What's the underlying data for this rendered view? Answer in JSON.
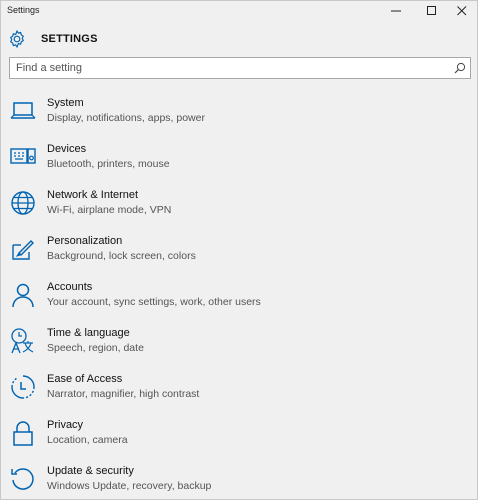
{
  "window": {
    "title": "Settings"
  },
  "header": {
    "title": "SETTINGS"
  },
  "search": {
    "placeholder": "Find a setting"
  },
  "colors": {
    "accent": "#0063b1",
    "background": "#f0f0f0"
  },
  "items": [
    {
      "icon": "laptop-icon",
      "label": "System",
      "description": "Display, notifications, apps, power"
    },
    {
      "icon": "keyboard-devices-icon",
      "label": "Devices",
      "description": "Bluetooth, printers, mouse"
    },
    {
      "icon": "globe-icon",
      "label": "Network & Internet",
      "description": "Wi-Fi, airplane mode, VPN"
    },
    {
      "icon": "paint-icon",
      "label": "Personalization",
      "description": "Background, lock screen, colors"
    },
    {
      "icon": "person-icon",
      "label": "Accounts",
      "description": "Your account, sync settings, work, other users"
    },
    {
      "icon": "language-icon",
      "label": "Time & language",
      "description": "Speech, region, date"
    },
    {
      "icon": "accessibility-icon",
      "label": "Ease of Access",
      "description": "Narrator, magnifier, high contrast"
    },
    {
      "icon": "lock-icon",
      "label": "Privacy",
      "description": "Location, camera"
    },
    {
      "icon": "update-icon",
      "label": "Update & security",
      "description": "Windows Update, recovery, backup"
    }
  ]
}
